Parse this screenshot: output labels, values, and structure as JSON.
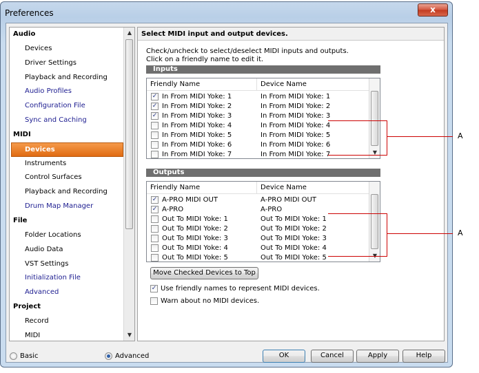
{
  "window": {
    "title": "Preferences",
    "close_glyph": "x"
  },
  "nav": {
    "items": [
      {
        "kind": "cat",
        "label": "Audio"
      },
      {
        "kind": "item",
        "label": "Devices"
      },
      {
        "kind": "item",
        "label": "Driver Settings"
      },
      {
        "kind": "item",
        "label": "Playback and Recording"
      },
      {
        "kind": "link",
        "label": "Audio Profiles"
      },
      {
        "kind": "link",
        "label": "Configuration File"
      },
      {
        "kind": "link",
        "label": "Sync and Caching"
      },
      {
        "kind": "cat",
        "label": "MIDI"
      },
      {
        "kind": "selected",
        "label": "Devices"
      },
      {
        "kind": "item",
        "label": "Instruments"
      },
      {
        "kind": "item",
        "label": "Control Surfaces"
      },
      {
        "kind": "item",
        "label": "Playback and Recording"
      },
      {
        "kind": "link",
        "label": "Drum Map Manager"
      },
      {
        "kind": "cat",
        "label": "File"
      },
      {
        "kind": "item",
        "label": "Folder Locations"
      },
      {
        "kind": "item",
        "label": "Audio Data"
      },
      {
        "kind": "item",
        "label": "VST Settings"
      },
      {
        "kind": "link",
        "label": "Initialization File"
      },
      {
        "kind": "link",
        "label": "Advanced"
      },
      {
        "kind": "cat",
        "label": "Project"
      },
      {
        "kind": "item",
        "label": "Record"
      },
      {
        "kind": "item",
        "label": "MIDI"
      }
    ]
  },
  "panel": {
    "header": "Select MIDI input and output devices.",
    "instructions_1": "Check/uncheck to select/deselect MIDI inputs and outputs.",
    "instructions_2": "Click on a friendly name to edit it.",
    "inputs": {
      "title": "Inputs",
      "col_friendly": "Friendly Name",
      "col_device": "Device Name",
      "rows": [
        {
          "checked": true,
          "friendly": "In From MIDI Yoke:  1",
          "device": "In From MIDI Yoke:  1"
        },
        {
          "checked": true,
          "friendly": "In From MIDI Yoke:  2",
          "device": "In From MIDI Yoke:  2"
        },
        {
          "checked": true,
          "friendly": "In From MIDI Yoke:  3",
          "device": "In From MIDI Yoke:  3"
        },
        {
          "checked": false,
          "friendly": "In From MIDI Yoke:  4",
          "device": "In From MIDI Yoke:  4"
        },
        {
          "checked": false,
          "friendly": "In From MIDI Yoke:  5",
          "device": "In From MIDI Yoke:  5"
        },
        {
          "checked": false,
          "friendly": "In From MIDI Yoke:  6",
          "device": "In From MIDI Yoke:  6"
        },
        {
          "checked": false,
          "friendly": "In From MIDI Yoke:  7",
          "device": "In From MIDI Yoke:  7"
        }
      ]
    },
    "outputs": {
      "title": "Outputs",
      "col_friendly": "Friendly Name",
      "col_device": "Device Name",
      "rows": [
        {
          "checked": true,
          "friendly": "A-PRO MIDI OUT",
          "device": "A-PRO MIDI OUT"
        },
        {
          "checked": true,
          "friendly": "A-PRO",
          "device": "A-PRO"
        },
        {
          "checked": false,
          "friendly": "Out To MIDI Yoke:  1",
          "device": "Out To MIDI Yoke:  1"
        },
        {
          "checked": false,
          "friendly": "Out To MIDI Yoke:  2",
          "device": "Out To MIDI Yoke:  2"
        },
        {
          "checked": false,
          "friendly": "Out To MIDI Yoke:  3",
          "device": "Out To MIDI Yoke:  3"
        },
        {
          "checked": false,
          "friendly": "Out To MIDI Yoke:  4",
          "device": "Out To MIDI Yoke:  4"
        },
        {
          "checked": false,
          "friendly": "Out To MIDI Yoke:  5",
          "device": "Out To MIDI Yoke:  5"
        }
      ]
    },
    "move_button": "Move Checked Devices to Top",
    "options": [
      {
        "checked": true,
        "label": "Use friendly names to represent MIDI devices."
      },
      {
        "checked": false,
        "label": "Warn about no MIDI devices."
      }
    ]
  },
  "footer": {
    "basic_label": "Basic",
    "advanced_label": "Advanced",
    "mode_selected": "Advanced",
    "ok": "OK",
    "cancel": "Cancel",
    "apply": "Apply",
    "help": "Help"
  },
  "annotations": {
    "inputs_label": "A",
    "outputs_label": "A",
    "color": "#cc0000"
  },
  "glyphs": {
    "check": "✓",
    "up": "▲",
    "down": "▼"
  }
}
